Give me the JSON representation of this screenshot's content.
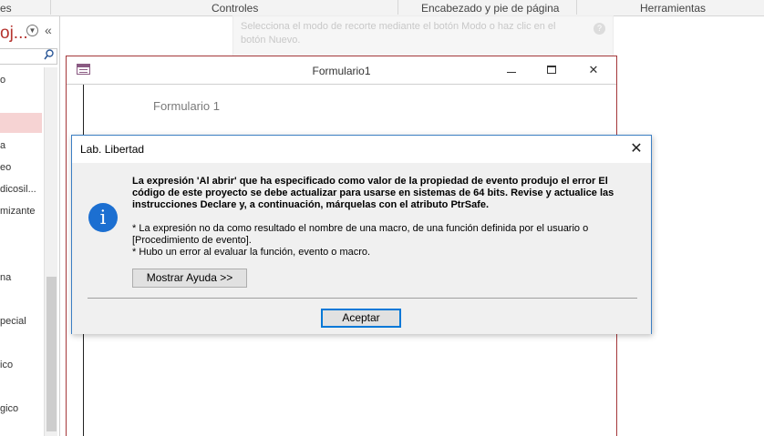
{
  "ribbon": {
    "groups": [
      "es",
      "Controles",
      "Encabezado y pie de página",
      "Herramientas"
    ]
  },
  "nav": {
    "title": "oj...",
    "dropdown_icon": "chevron-down-circle-icon",
    "collapse_icon": "double-chevron-left-icon",
    "search_icon": "search-icon",
    "items": [
      "o",
      "a",
      "eo",
      "dicosil...",
      "mizante",
      "na",
      "pecial",
      "ico",
      "gico"
    ]
  },
  "tooltip": {
    "text": "Selecciona el modo de recorte mediante el botón Modo o haz clic en el botón Nuevo.",
    "help_icon": "?"
  },
  "form": {
    "title": "Formulario1",
    "heading": "Formulario 1",
    "icon": "form-icon",
    "close_glyph": "✕"
  },
  "dialog": {
    "title": "Lab. Libertad",
    "close_glyph": "✕",
    "icon": "i",
    "message_bold": "La expresión 'Al abrir' que ha especificado como valor de la propiedad de evento produjo el error El código de este proyecto se debe actualizar para usarse en sistemas de 64 bits. Revise y actualice las instrucciones Declare y, a continuación, márquelas con el atributo PtrSafe.",
    "message_line1": "* La expresión no da como resultado el nombre de una macro, de una función definida por el usuario o [Procedimiento de evento].",
    "message_line2": "* Hubo un error al evaluar la función, evento o macro.",
    "help_button": "Mostrar Ayuda >>",
    "ok_button": "Aceptar"
  }
}
